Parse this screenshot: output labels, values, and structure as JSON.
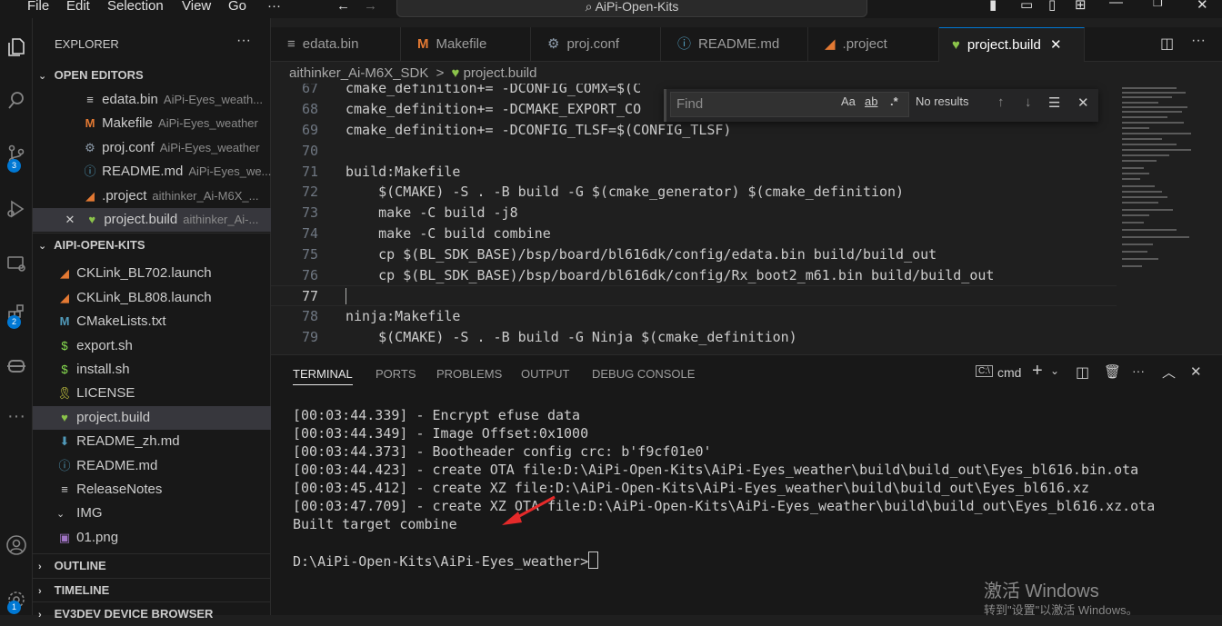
{
  "menu": [
    "File",
    "Edit",
    "Selection",
    "View",
    "Go",
    "···"
  ],
  "search": {
    "text": "AiPi-Open-Kits"
  },
  "activity": {
    "badges": [
      "3",
      "2",
      "1"
    ]
  },
  "explorer": {
    "title": "EXPLORER",
    "open_editors_label": "OPEN EDITORS",
    "open_editors": [
      {
        "name": "edata.bin",
        "desc": "AiPi-Eyes_weath..."
      },
      {
        "name": "Makefile",
        "desc": "AiPi-Eyes_weather"
      },
      {
        "name": "proj.conf",
        "desc": "AiPi-Eyes_weather"
      },
      {
        "name": "README.md",
        "desc": "AiPi-Eyes_we..."
      },
      {
        "name": ".project",
        "desc": "aithinker_Ai-M6X_..."
      },
      {
        "name": "project.build",
        "desc": "aithinker_Ai-..."
      }
    ],
    "folder_label": "AIPI-OPEN-KITS",
    "files": [
      "CKLink_BL702.launch",
      "CKLink_BL808.launch",
      "CMakeLists.txt",
      "export.sh",
      "install.sh",
      "LICENSE",
      "project.build",
      "README_zh.md",
      "README.md",
      "ReleaseNotes",
      "IMG",
      "01.png"
    ],
    "outline_label": "OUTLINE",
    "timeline_label": "TIMELINE",
    "ev3_label": "EV3DEV DEVICE BROWSER"
  },
  "tabs": [
    "edata.bin",
    "Makefile",
    "proj.conf",
    "README.md",
    ".project",
    "project.build"
  ],
  "breadcrumb": {
    "folder": "aithinker_Ai-M6X_SDK",
    "sep": ">",
    "file": "project.build"
  },
  "editor": {
    "lines": [
      {
        "n": "67",
        "code": "cmake_definition+= -DCONFIG_COMX=$(C"
      },
      {
        "n": "68",
        "code": "cmake_definition+= -DCMAKE_EXPORT_CO"
      },
      {
        "n": "69",
        "code": "cmake_definition+= -DCONFIG_TLSF=$(CONFIG_TLSF)"
      },
      {
        "n": "70",
        "code": ""
      },
      {
        "n": "71",
        "code": "build:Makefile"
      },
      {
        "n": "72",
        "code": "    $(CMAKE) -S . -B build -G $(cmake_generator) $(cmake_definition)"
      },
      {
        "n": "73",
        "code": "    make -C build -j8"
      },
      {
        "n": "74",
        "code": "    make -C build combine"
      },
      {
        "n": "75",
        "code": "    cp $(BL_SDK_BASE)/bsp/board/bl616dk/config/edata.bin build/build_out"
      },
      {
        "n": "76",
        "code": "    cp $(BL_SDK_BASE)/bsp/board/bl616dk/config/Rx_boot2_m61.bin build/build_out"
      },
      {
        "n": "77",
        "code": ""
      },
      {
        "n": "78",
        "code": "ninja:Makefile"
      },
      {
        "n": "79",
        "code": "    $(CMAKE) -S . -B build -G Ninja $(cmake_definition)"
      }
    ]
  },
  "find": {
    "placeholder": "Find",
    "case_label": "Aa",
    "word_label": "ab",
    "regex_label": ".*",
    "status": "No results"
  },
  "panel": {
    "tabs": [
      "TERMINAL",
      "PORTS",
      "PROBLEMS",
      "OUTPUT",
      "DEBUG CONSOLE"
    ],
    "shell": "cmd",
    "terminal_lines": [
      "[00:03:44.339] - Encrypt efuse data",
      "[00:03:44.349] - Image Offset:0x1000",
      "[00:03:44.373] - Bootheader config crc: b'f9cf01e0'",
      "[00:03:44.423] - create OTA file:D:\\AiPi-Open-Kits\\AiPi-Eyes_weather\\build\\build_out\\Eyes_bl616.bin.ota",
      "[00:03:45.412] - create XZ file:D:\\AiPi-Open-Kits\\AiPi-Eyes_weather\\build\\build_out\\Eyes_bl616.xz",
      "[00:03:47.709] - create XZ OTA file:D:\\AiPi-Open-Kits\\AiPi-Eyes_weather\\build\\build_out\\Eyes_bl616.xz.ota",
      "Built target combine",
      "",
      "D:\\AiPi-Open-Kits\\AiPi-Eyes_weather>"
    ]
  },
  "watermark": {
    "line1": "激活 Windows",
    "line2": "转到\"设置\"以激活 Windows。"
  },
  "colors": {
    "accent": "#0078d4",
    "arrow": "#e52a2a",
    "heart": "#8bc34a"
  }
}
